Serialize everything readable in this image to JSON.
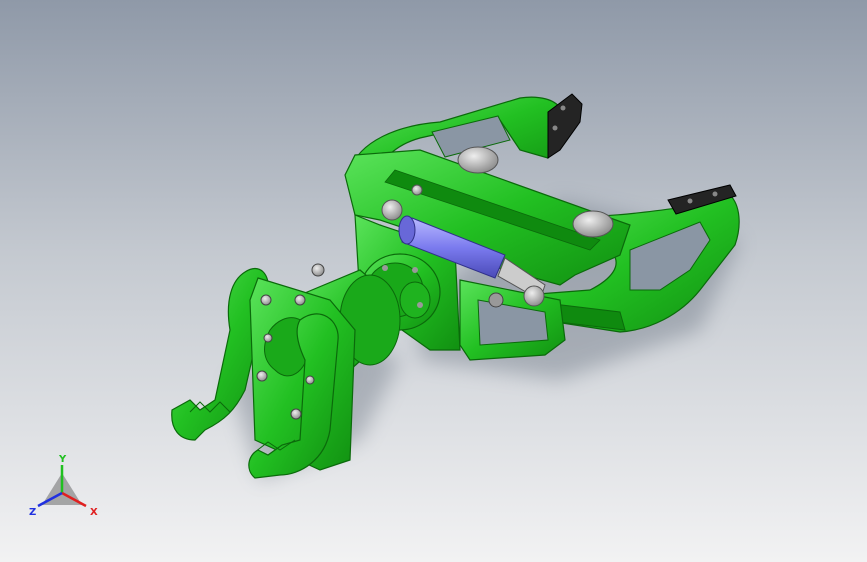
{
  "viewport": {
    "background_top": "#8f99a8",
    "background_bottom": "#f2f2f3"
  },
  "model": {
    "body_color": "#22c022",
    "body_shade": "#139013",
    "body_light": "#55e055",
    "cylinder_color": "#8080ee",
    "pad_color": "#222222",
    "bolt_color": "#aaaaaa"
  },
  "triad": {
    "x_label": "X",
    "y_label": "Y",
    "z_label": "Z",
    "x_color": "#e02020",
    "y_color": "#20c020",
    "z_color": "#2030e0"
  }
}
